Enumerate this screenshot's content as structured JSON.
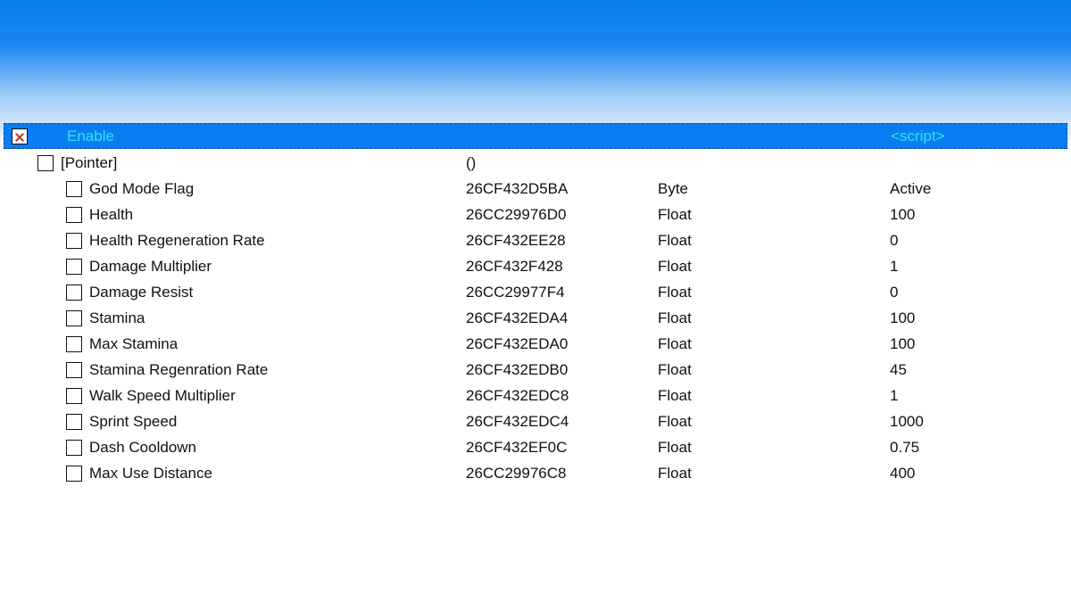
{
  "header": {
    "label": "Enable",
    "script": "<script>"
  },
  "pointer": {
    "label": "[Pointer]",
    "address": "()",
    "type": "",
    "value": ""
  },
  "entries": [
    {
      "label": "God Mode Flag",
      "address": "26CF432D5BA",
      "type": "Byte",
      "value": "Active"
    },
    {
      "label": "Health",
      "address": "26CC29976D0",
      "type": "Float",
      "value": "100"
    },
    {
      "label": "Health Regeneration Rate",
      "address": "26CF432EE28",
      "type": "Float",
      "value": "0"
    },
    {
      "label": "Damage Multiplier",
      "address": "26CF432F428",
      "type": "Float",
      "value": "1"
    },
    {
      "label": "Damage Resist",
      "address": "26CC29977F4",
      "type": "Float",
      "value": "0"
    },
    {
      "label": "Stamina",
      "address": "26CF432EDA4",
      "type": "Float",
      "value": "100"
    },
    {
      "label": "Max Stamina",
      "address": "26CF432EDA0",
      "type": "Float",
      "value": "100"
    },
    {
      "label": "Stamina Regenration Rate",
      "address": "26CF432EDB0",
      "type": "Float",
      "value": "45"
    },
    {
      "label": "Walk Speed Multiplier",
      "address": "26CF432EDC8",
      "type": "Float",
      "value": "1"
    },
    {
      "label": "Sprint Speed",
      "address": "26CF432EDC4",
      "type": "Float",
      "value": "1000"
    },
    {
      "label": "Dash Cooldown",
      "address": "26CF432EF0C",
      "type": "Float",
      "value": "0.75"
    },
    {
      "label": "Max Use Distance",
      "address": "26CC29976C8",
      "type": "Float",
      "value": "400"
    }
  ]
}
